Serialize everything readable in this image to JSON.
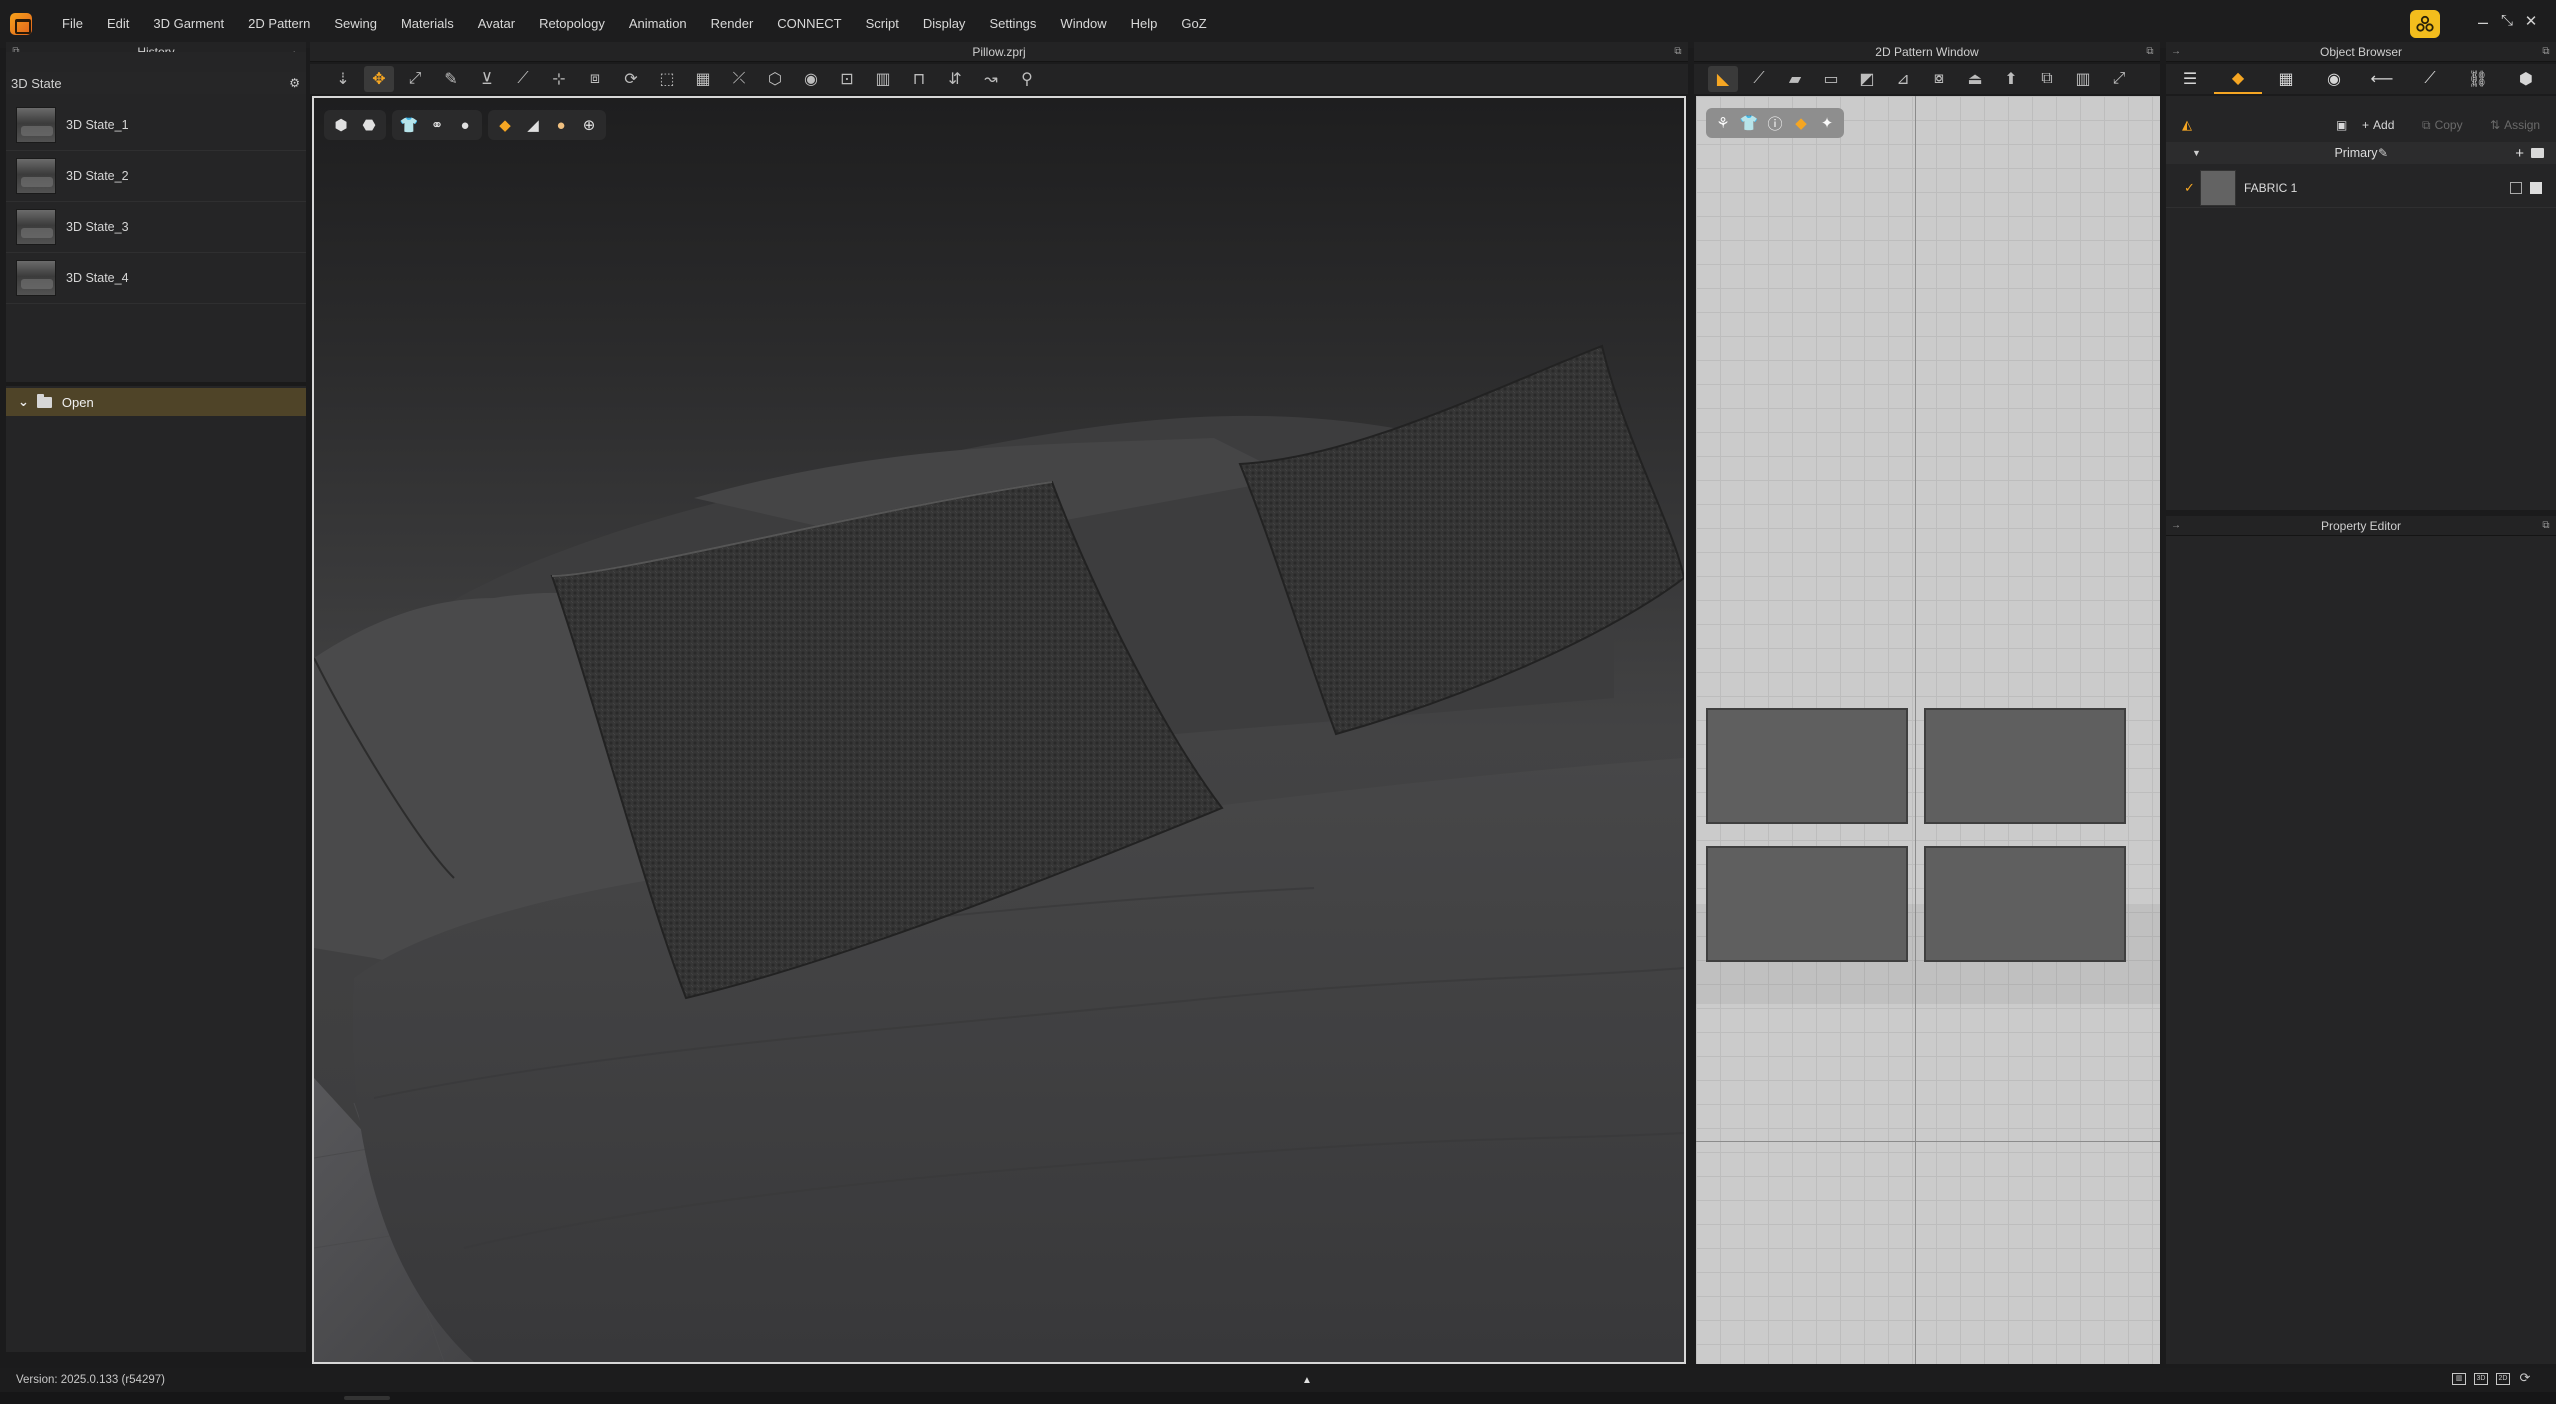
{
  "menu": {
    "items": [
      "File",
      "Edit",
      "3D Garment",
      "2D Pattern",
      "Sewing",
      "Materials",
      "Avatar",
      "Retopology",
      "Animation",
      "Render",
      "CONNECT",
      "Script",
      "Display",
      "Settings",
      "Window",
      "Help",
      "GoZ"
    ]
  },
  "window_controls": {
    "minimize": "–",
    "restore": "⤡",
    "close": "✕"
  },
  "history": {
    "title": "History",
    "state_label": "3D State",
    "items": [
      "3D State_1",
      "3D State_2",
      "3D State_3",
      "3D State_4"
    ],
    "open_label": "Open"
  },
  "view3d": {
    "title": "Pillow.zprj"
  },
  "view2d": {
    "title": "2D Pattern Window"
  },
  "object_browser": {
    "title": "Object Browser",
    "add_label": "Add",
    "copy_label": "Copy",
    "assign_label": "Assign",
    "group_label": "Primary",
    "fabric_name": "FABRIC 1"
  },
  "property_editor": {
    "title": "Property Editor"
  },
  "status": {
    "version": "Version: 2025.0.133 (r54297)"
  },
  "colors": {
    "accent": "#f5a623",
    "open_row": "#4f4428",
    "pattern_piece": "#5f5f5f",
    "grid_bg": "#cbcbcb"
  }
}
